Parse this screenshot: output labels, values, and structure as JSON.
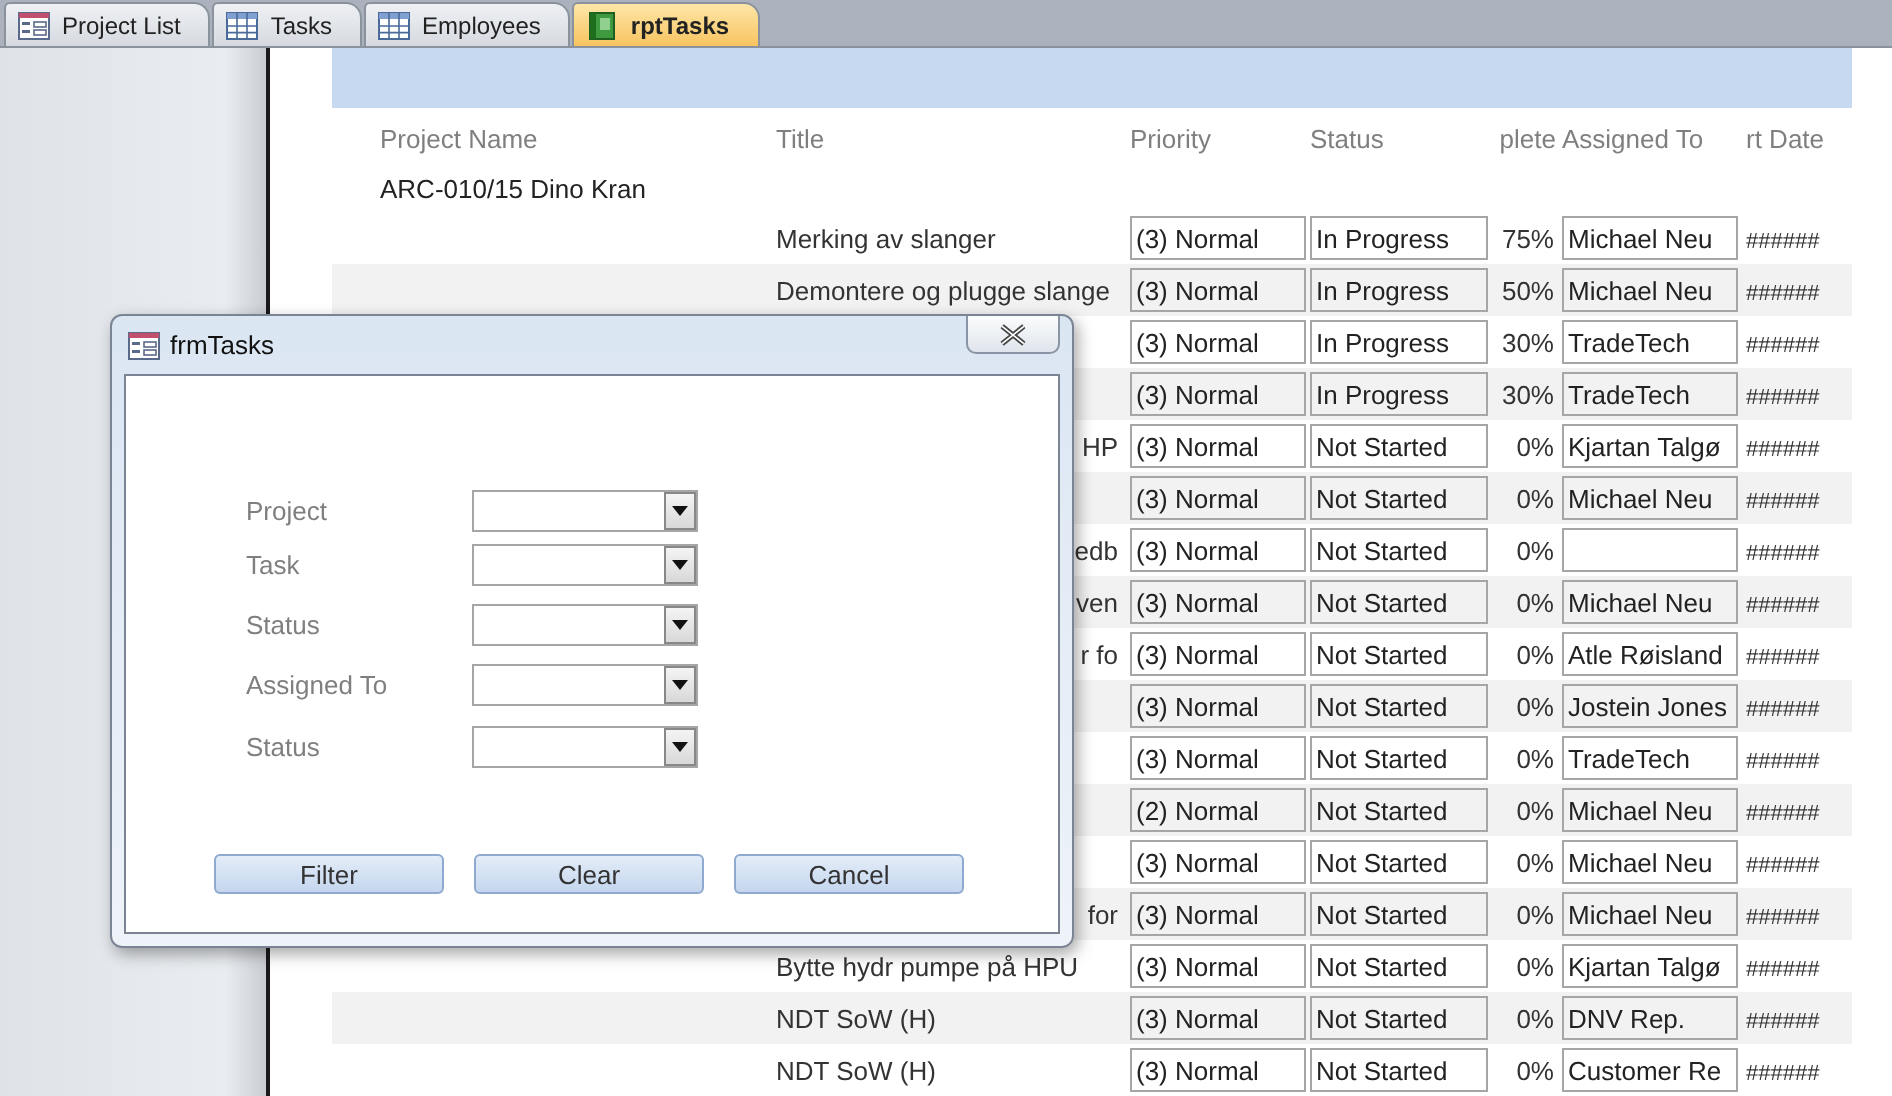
{
  "tabs": [
    {
      "label": "Project List",
      "kind": "form",
      "selected": false
    },
    {
      "label": "Tasks",
      "kind": "table",
      "selected": false
    },
    {
      "label": "Employees",
      "kind": "table",
      "selected": false
    },
    {
      "label": "rptTasks",
      "kind": "report",
      "selected": true
    }
  ],
  "report": {
    "columns": [
      "Project Name",
      "Title",
      "Priority",
      "Status",
      "plete",
      "Assigned To",
      "rt Date"
    ],
    "project": "ARC-010/15 Dino Kran",
    "rows": [
      {
        "title": "Merking av slanger",
        "priority": "(3) Normal",
        "status": "In Progress",
        "percent": "75%",
        "assigned_to": "Michael Neu",
        "start_date": "######"
      },
      {
        "title": "Demontere og plugge slange",
        "priority": "(3) Normal",
        "status": "In Progress",
        "percent": "50%",
        "assigned_to": "Michael Neu",
        "start_date": "######"
      },
      {
        "priority": "(3) Normal",
        "status": "In Progress",
        "percent": "30%",
        "assigned_to": "TradeTech",
        "start_date": "######"
      },
      {
        "priority": "(3) Normal",
        "status": "In Progress",
        "percent": "30%",
        "assigned_to": "TradeTech",
        "start_date": "######"
      },
      {
        "title_tail": "HP",
        "priority": "(3) Normal",
        "status": "Not Started",
        "percent": "0%",
        "assigned_to": "Kjartan Talgø",
        "start_date": "######"
      },
      {
        "priority": "(3) Normal",
        "status": "Not Started",
        "percent": "0%",
        "assigned_to": "Michael Neu",
        "start_date": "######"
      },
      {
        "title_tail": "edb",
        "priority": "(3) Normal",
        "status": "Not Started",
        "percent": "0%",
        "start_date": "######"
      },
      {
        "title_tail": "ven",
        "priority": "(3) Normal",
        "status": "Not Started",
        "percent": "0%",
        "assigned_to": "Michael Neu",
        "start_date": "######"
      },
      {
        "title_tail": "r fo",
        "priority": "(3) Normal",
        "status": "Not Started",
        "percent": "0%",
        "assigned_to": "Atle Røisland",
        "start_date": "######"
      },
      {
        "priority": "(3) Normal",
        "status": "Not Started",
        "percent": "0%",
        "assigned_to": "Jostein Jones",
        "start_date": "######"
      },
      {
        "priority": "(3) Normal",
        "status": "Not Started",
        "percent": "0%",
        "assigned_to": "TradeTech",
        "start_date": "######"
      },
      {
        "priority": "(2) Normal",
        "status": "Not Started",
        "percent": "0%",
        "assigned_to": "Michael Neu",
        "start_date": "######"
      },
      {
        "priority": "(3) Normal",
        "status": "Not Started",
        "percent": "0%",
        "assigned_to": "Michael Neu",
        "start_date": "######"
      },
      {
        "title_tail": "for",
        "priority": "(3) Normal",
        "status": "Not Started",
        "percent": "0%",
        "assigned_to": "Michael Neu",
        "start_date": "######"
      },
      {
        "title": "Bytte hydr pumpe på HPU",
        "priority": "(3) Normal",
        "status": "Not Started",
        "percent": "0%",
        "assigned_to": "Kjartan Talgø",
        "start_date": "######"
      },
      {
        "title": "NDT SoW (H)",
        "priority": "(3) Normal",
        "status": "Not Started",
        "percent": "0%",
        "assigned_to": "DNV Rep.",
        "start_date": "######"
      },
      {
        "title": "NDT SoW (H)",
        "priority": "(3) Normal",
        "status": "Not Started",
        "percent": "0%",
        "assigned_to": "Customer Re",
        "start_date": "######"
      }
    ]
  },
  "dialog": {
    "title": "frmTasks",
    "fields": [
      {
        "label": "Project"
      },
      {
        "label": "Task"
      },
      {
        "label": "Status"
      },
      {
        "label": "Assigned To"
      },
      {
        "label": "Status"
      }
    ],
    "buttons": [
      "Filter",
      "Clear",
      "Cancel"
    ]
  }
}
